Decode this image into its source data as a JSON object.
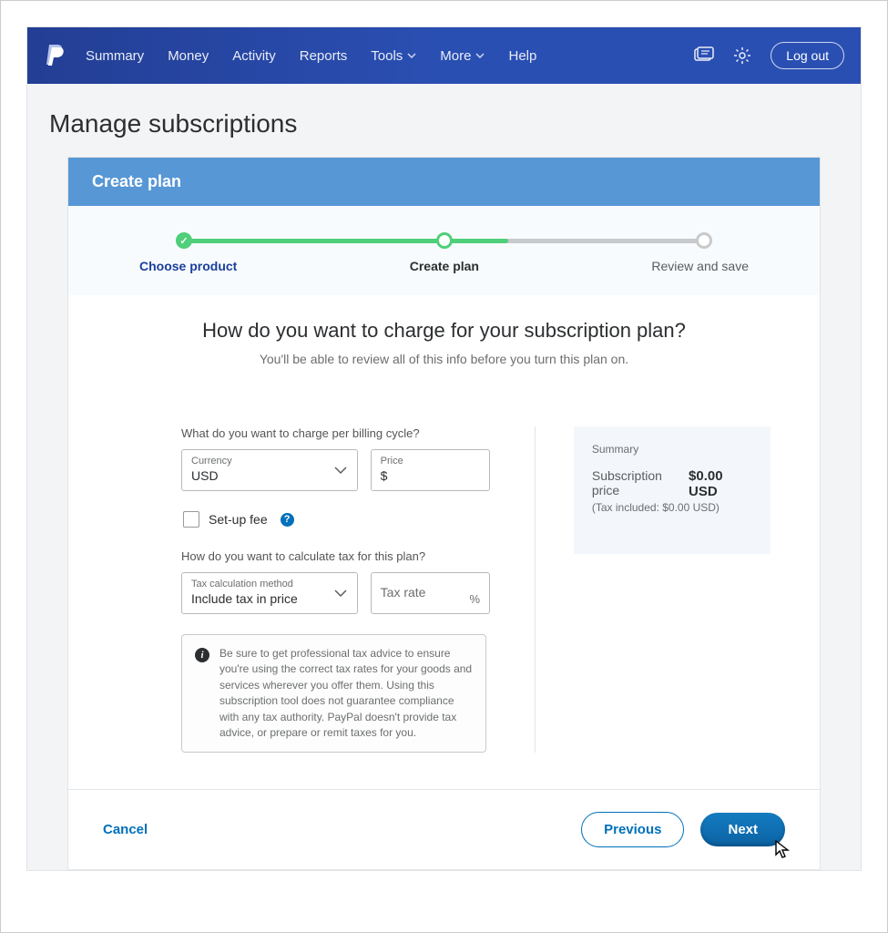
{
  "nav": {
    "items": [
      "Summary",
      "Money",
      "Activity",
      "Reports",
      "Tools",
      "More",
      "Help"
    ],
    "logout": "Log out"
  },
  "page": {
    "title": "Manage subscriptions"
  },
  "card": {
    "title": "Create plan"
  },
  "stepper": {
    "step1": "Choose product",
    "step2": "Create plan",
    "step3": "Review and save"
  },
  "form": {
    "heading": "How do you want to charge for your subscription plan?",
    "subheading": "You'll be able to review all of this info before you turn this plan on.",
    "q_charge": "What do you want to charge per billing cycle?",
    "currency_label": "Currency",
    "currency_value": "USD",
    "price_label": "Price",
    "price_value": "$",
    "setup_fee": "Set-up fee",
    "q_tax": "How do you want to calculate tax for this plan?",
    "tax_method_label": "Tax calculation method",
    "tax_method_value": "Include tax in price",
    "tax_rate_label": "Tax rate",
    "tax_rate_suffix": "%",
    "info_text": "Be sure to get professional tax advice to ensure you're using the correct tax rates for your goods and services wherever you offer them. Using this subscription tool does not guarantee compliance with any tax authority. PayPal doesn't provide tax advice, or prepare or remit taxes for you."
  },
  "summary": {
    "title": "Summary",
    "price_label": "Subscription price",
    "price_value": "$0.00 USD",
    "tax_included": "(Tax included: $0.00 USD)"
  },
  "footer": {
    "cancel": "Cancel",
    "previous": "Previous",
    "next": "Next"
  }
}
